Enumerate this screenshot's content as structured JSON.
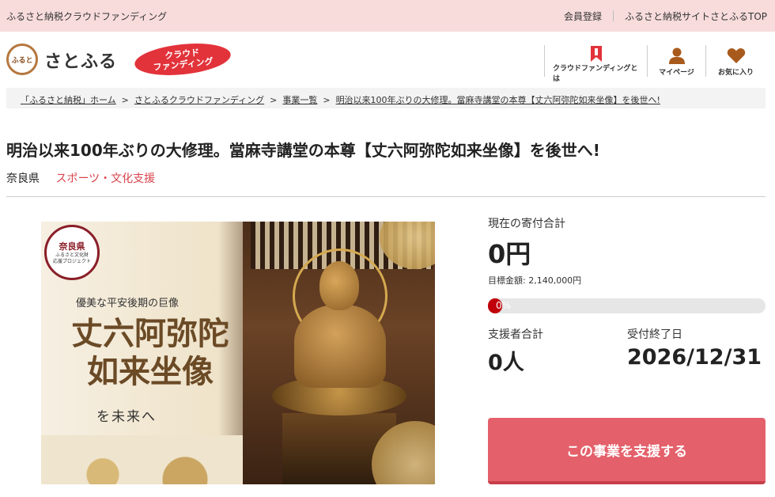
{
  "topbar": {
    "left_text": "ふるさと納税クラウドファンディング",
    "links": [
      "会員登録",
      "ふるさと納税サイトさとふるTOP"
    ]
  },
  "header": {
    "logo_seal_text": "ふると",
    "logo_text": "さとふる",
    "badge_line1": "クラウド",
    "badge_line2": "ファンディング",
    "nav": [
      {
        "label": "クラウドファンディングとは",
        "icon": "bookmark-icon"
      },
      {
        "label": "マイページ",
        "icon": "person-icon"
      },
      {
        "label": "お気に入り",
        "icon": "heart-icon"
      }
    ]
  },
  "breadcrumb": [
    "「ふるさと納税」ホーム",
    "さとふるクラウドファンディング",
    "事業一覧",
    "明治以来100年ぶりの大修理。當麻寺講堂の本尊【丈六阿弥陀如来坐像】を後世へ!"
  ],
  "breadcrumb_sep": ">",
  "project": {
    "title": "明治以来100年ぶりの大修理。當麻寺講堂の本尊【丈六阿弥陀如来坐像】を後世へ!",
    "prefecture": "奈良県",
    "category": "スポーツ・文化支援"
  },
  "hero": {
    "seal_title": "奈良県",
    "seal_sub": "ふるさと文化財\n応援プロジェクト",
    "subtitle": "優美な平安後期の巨像",
    "big_line1": "丈六阿弥陀",
    "big_line2": "如来坐像",
    "tagline": "を未来へ"
  },
  "stats": {
    "total_label": "現在の寄付合計",
    "total_value": "0円",
    "goal_text": "目標金額: 2,140,000円",
    "progress_text": "0%",
    "progress_fraction": 0,
    "supporters_label": "支援者合計",
    "supporters_value": "0人",
    "deadline_label": "受付終了日",
    "deadline_value": "2026/12/31"
  },
  "cta_label": "この事業を支援する",
  "colors": {
    "topbar_bg": "#f8dcdc",
    "accent_red": "#d9434b",
    "cta_bg": "#e4606a",
    "progress_fill": "#c0000b"
  }
}
